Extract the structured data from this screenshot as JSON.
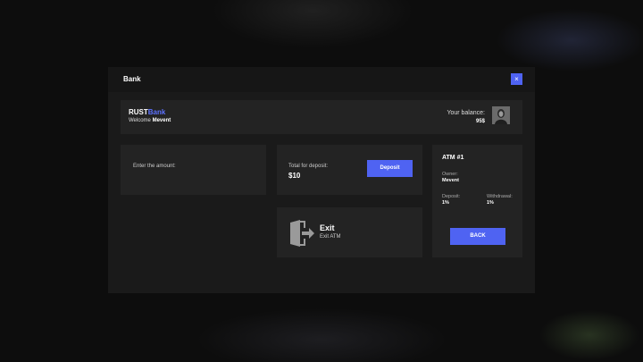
{
  "modal": {
    "title": "Bank",
    "close_label": "×"
  },
  "header": {
    "brand_part1": "RUST",
    "brand_part2": "Bank",
    "welcome_prefix": "Welcome",
    "username": "Mevent",
    "balance_label": "Your balance:",
    "balance_value": "95$"
  },
  "amount": {
    "label": "Enter the amount:"
  },
  "deposit": {
    "label": "Total for deposit:",
    "value": "$10",
    "button_label": "Deposit"
  },
  "exit": {
    "title": "Exit",
    "subtitle": "Exit ATM",
    "icon": "exit-door-icon"
  },
  "atm": {
    "title": "ATM #1",
    "owner_label": "Owner:",
    "owner": "Mevent",
    "deposit_label": "Deposit:",
    "deposit_fee": "1%",
    "withdrawal_label": "Withdrawal:",
    "withdrawal_fee": "1%",
    "back_label": "BACK"
  },
  "colors": {
    "accent": "#4f63f2",
    "brand_highlight": "#5d72ff",
    "panel": "#232323",
    "modal": "#1a1a1a"
  }
}
